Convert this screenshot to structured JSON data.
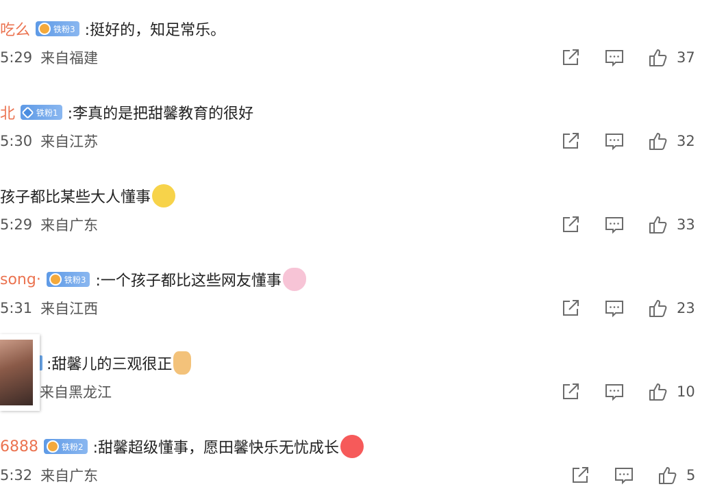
{
  "comments": [
    {
      "username": "吃么",
      "badge": {
        "label": "铁粉3",
        "icon_name": "badge-medal-icon"
      },
      "text": ":挺好的，知足常乐。",
      "emoji": "",
      "time": "5:29",
      "location": "来自福建",
      "likes": "37"
    },
    {
      "username": "北",
      "badge": {
        "label": "铁粉1",
        "icon_name": "badge-diamond-icon"
      },
      "text": ":李真的是把甜馨教育的很好",
      "emoji": "",
      "time": "5:30",
      "location": "来自江苏",
      "likes": "32"
    },
    {
      "username": "",
      "badge": null,
      "text": "孩子都比某些大人懂事",
      "emoji": "smirk-emoji",
      "time": "5:29",
      "location": "来自广东",
      "likes": "33"
    },
    {
      "username": "song·",
      "badge": {
        "label": "铁粉3",
        "icon_name": "badge-medal-icon"
      },
      "text": ":一个孩子都比这些网友懂事",
      "emoji": "bunny-emoji",
      "time": "5:31",
      "location": "来自江西",
      "likes": "23"
    },
    {
      "username": "",
      "badge": null,
      "text": ":甜馨儿的三观很正",
      "emoji": "thumbs-up-emoji",
      "time": "",
      "location": "来自黑龙江",
      "likes": "10"
    },
    {
      "username": "6888",
      "badge": {
        "label": "铁粉2",
        "icon_name": "badge-medal-icon"
      },
      "text": ":甜馨超级懂事，愿田馨快乐无忧成长",
      "emoji": "flushed-emoji",
      "time": "5:32",
      "location": "来自广东",
      "likes": "5"
    }
  ],
  "colors": {
    "username": "#eb7350",
    "badge": "#5e9ae6",
    "text": "#222222",
    "meta": "#555555",
    "icon": "#6b6b6b"
  },
  "icons": {
    "share": "share-icon",
    "comment": "comment-icon",
    "like": "thumbs-up-icon"
  }
}
